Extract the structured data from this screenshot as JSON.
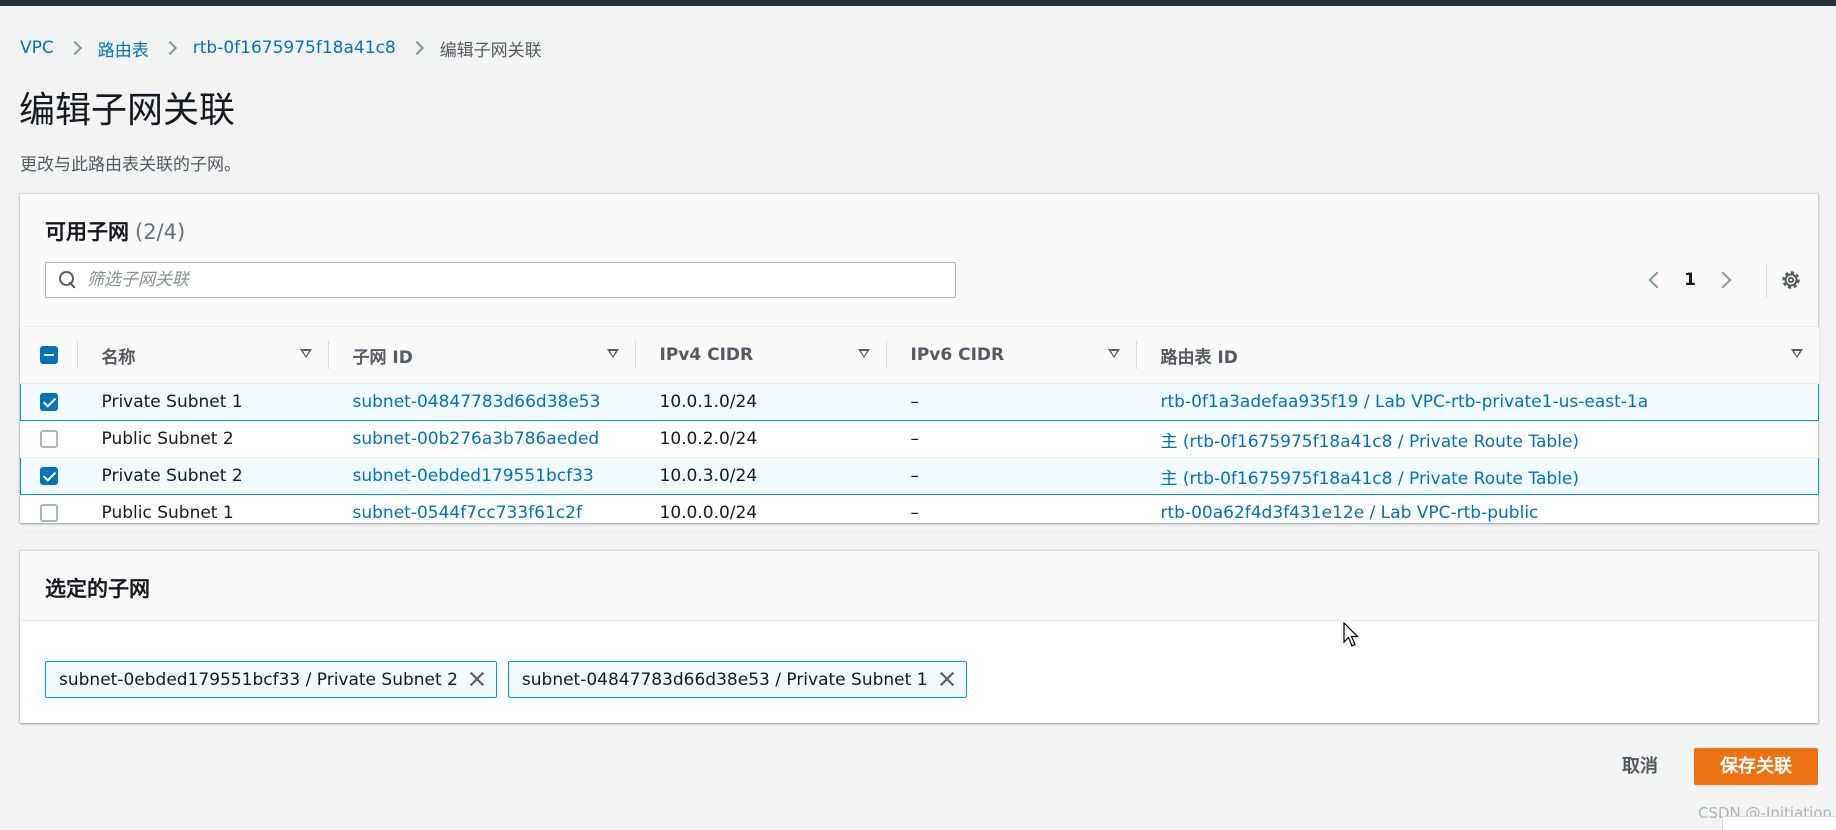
{
  "breadcrumb": {
    "items": [
      "VPC",
      "路由表",
      "rtb-0f1675975f18a41c8"
    ],
    "current": "编辑子网关联"
  },
  "page": {
    "title": "编辑子网关联",
    "description": "更改与此路由表关联的子网。"
  },
  "available_subnets": {
    "title": "可用子网",
    "count": "(2/4)",
    "search_placeholder": "筛选子网关联",
    "page_number": "1",
    "columns": [
      "名称",
      "子网 ID",
      "IPv4 CIDR",
      "IPv6 CIDR",
      "路由表 ID"
    ],
    "rows": [
      {
        "name": "Private Subnet 1",
        "subnet_id": "subnet-04847783d66d38e53",
        "ipv4": "10.0.1.0/24",
        "ipv6": "–",
        "route_table": "rtb-0f1a3adefaa935f19 / Lab VPC-rtb-private1-us-east-1a",
        "selected": true
      },
      {
        "name": "Public Subnet 2",
        "subnet_id": "subnet-00b276a3b786aeded",
        "ipv4": "10.0.2.0/24",
        "ipv6": "–",
        "route_table": "主 (rtb-0f1675975f18a41c8 / Private Route Table)",
        "selected": false
      },
      {
        "name": "Private Subnet 2",
        "subnet_id": "subnet-0ebded179551bcf33",
        "ipv4": "10.0.3.0/24",
        "ipv6": "–",
        "route_table": "主 (rtb-0f1675975f18a41c8 / Private Route Table)",
        "selected": true
      },
      {
        "name": "Public Subnet 1",
        "subnet_id": "subnet-0544f7cc733f61c2f",
        "ipv4": "10.0.0.0/24",
        "ipv6": "–",
        "route_table": "rtb-00a62f4d3f431e12e / Lab VPC-rtb-public",
        "selected": false
      }
    ]
  },
  "selected_subnets": {
    "title": "选定的子网",
    "tokens": [
      "subnet-0ebded179551bcf33 / Private Subnet 2",
      "subnet-04847783d66d38e53 / Private Subnet 1"
    ]
  },
  "actions": {
    "cancel": "取消",
    "save": "保存关联"
  },
  "watermark": "CSDN @-Initiation",
  "colors": {
    "link": "#0073bb",
    "primary_button": "#ec7211",
    "selected_row_border": "#00a1c9",
    "top_bar": "#232f3e"
  },
  "icons": [
    "search-icon",
    "settings-gear-icon",
    "close-icon",
    "chevron-left-icon",
    "chevron-right-icon",
    "sort-icon",
    "cursor-icon"
  ]
}
